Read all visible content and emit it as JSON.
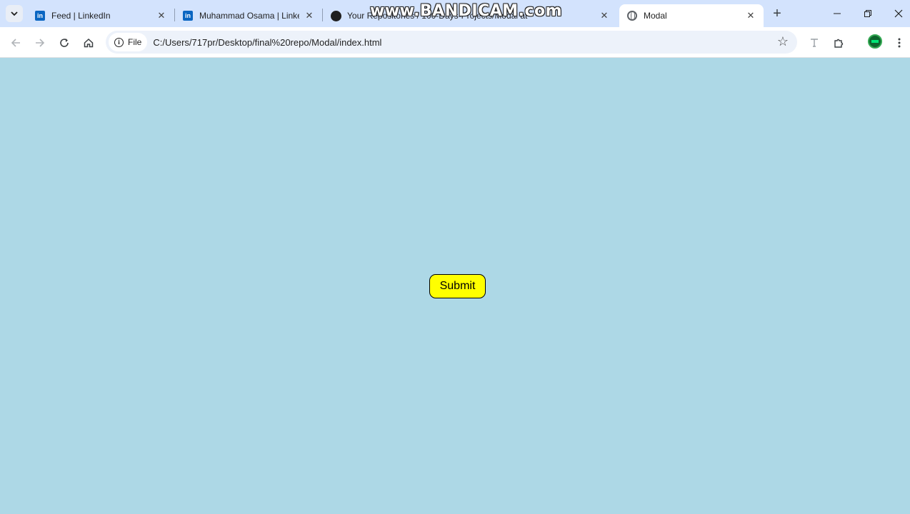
{
  "tabs": [
    {
      "label": "Feed | LinkedIn",
      "favicon": "linkedin-icon"
    },
    {
      "label": "Muhammad Osama | LinkedIn",
      "favicon": "linkedin-icon"
    },
    {
      "label": "Your Repositories / 100-Days-Projects/Modal at",
      "favicon": "github-icon"
    },
    {
      "label": "Modal",
      "favicon": "globe-icon",
      "active": true
    }
  ],
  "watermark": "www.BANDICAM.com",
  "toolbar": {
    "site_chip": "File",
    "url": "C:/Users/717pr/Desktop/final%20repo/Modal/index.html"
  },
  "page": {
    "submit_label": "Submit",
    "background": "#add8e6",
    "button_color": "#ffff00"
  }
}
